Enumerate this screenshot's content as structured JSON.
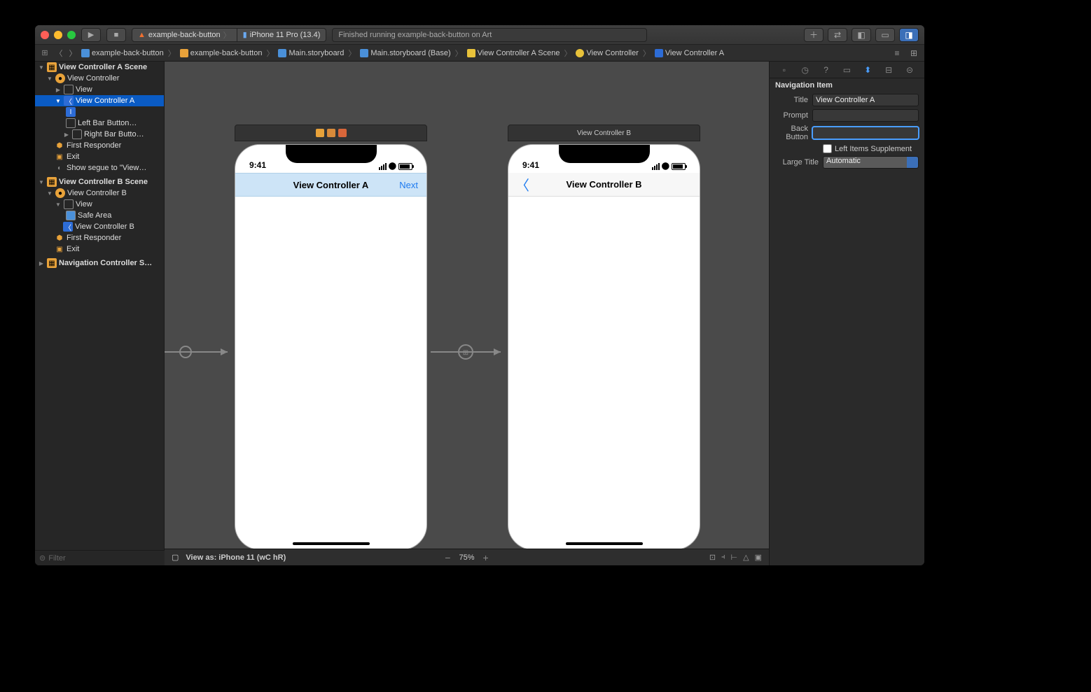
{
  "titlebar": {
    "scheme_target": "example-back-button",
    "scheme_device": "iPhone 11 Pro (13.4)",
    "status": "Finished running example-back-button on Art"
  },
  "breadcrumb": [
    {
      "icon": "blue",
      "label": "example-back-button"
    },
    {
      "icon": "orange",
      "label": "example-back-button"
    },
    {
      "icon": "blue",
      "label": "Main.storyboard"
    },
    {
      "icon": "blue",
      "label": "Main.storyboard (Base)"
    },
    {
      "icon": "yellow",
      "label": "View Controller A Scene"
    },
    {
      "icon": "yellow",
      "label": "View Controller"
    },
    {
      "icon": "nav",
      "label": "View Controller A"
    }
  ],
  "outline": {
    "sceneA": {
      "title": "View Controller A Scene",
      "vc": "View Controller",
      "view": "View",
      "navItem": "View Controller A",
      "sub1": "I",
      "left": "Left Bar Button…",
      "right": "Right Bar Butto…",
      "first": "First Responder",
      "exit": "Exit",
      "segue": "Show segue to \"View…"
    },
    "sceneB": {
      "title": "View Controller B Scene",
      "vc": "View Controller B",
      "view": "View",
      "safe": "Safe Area",
      "navItem": "View Controller B",
      "first": "First Responder",
      "exit": "Exit"
    },
    "navScene": "Navigation Controller S…",
    "filter_placeholder": "Filter"
  },
  "canvas": {
    "phoneA": {
      "time": "9:41",
      "title": "View Controller A",
      "next": "Next"
    },
    "phoneB": {
      "header": "View Controller B",
      "time": "9:41",
      "title": "View Controller B"
    },
    "footer": {
      "viewas": "View as: iPhone 11 (wC hR)",
      "zoom": "75%"
    }
  },
  "inspector": {
    "section": "Navigation Item",
    "title_label": "Title",
    "title_value": "View Controller A",
    "prompt_label": "Prompt",
    "prompt_value": "",
    "back_label": "Back Button",
    "back_value": "",
    "left_supp": "Left Items Supplement",
    "large_label": "Large Title",
    "large_value": "Automatic"
  }
}
